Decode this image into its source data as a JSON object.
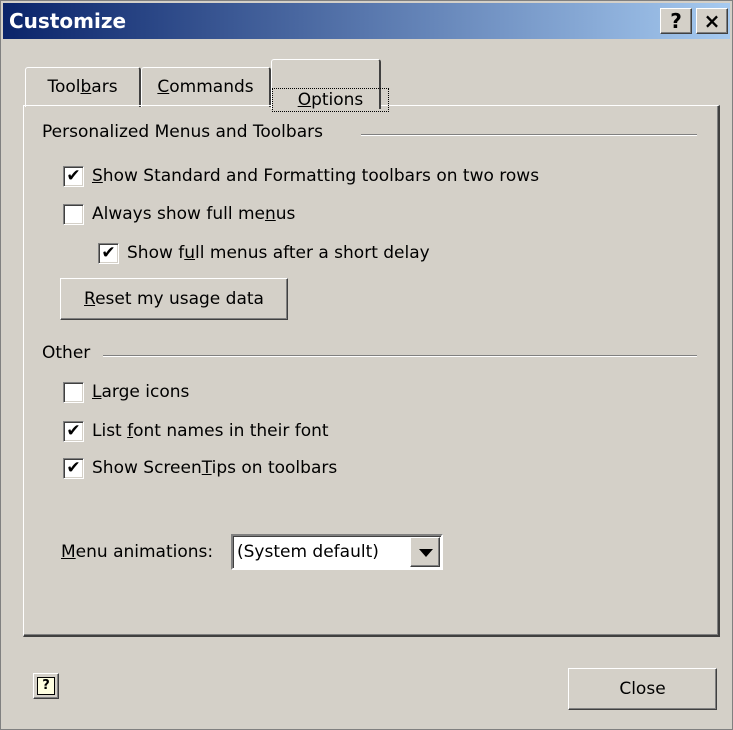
{
  "window": {
    "title": "Customize",
    "help_glyph": "?",
    "close_glyph": "×"
  },
  "tabs": [
    {
      "label": "Toolbars",
      "accel": "b",
      "selected": false
    },
    {
      "label": "Commands",
      "accel": "C",
      "selected": false
    },
    {
      "label": "Options",
      "accel": "O",
      "selected": true
    }
  ],
  "personalized": {
    "title": "Personalized Menus and Toolbars",
    "two_rows": {
      "label": "Show Standard and Formatting toolbars on two rows",
      "checked": true
    },
    "full_menus": {
      "label": "Always show full menus",
      "checked": false
    },
    "delay": {
      "label": "Show full menus after a short delay",
      "checked": true
    },
    "reset_label": "Reset my usage data"
  },
  "other": {
    "title": "Other",
    "large_icons": {
      "label": "Large icons",
      "checked": false
    },
    "font_names": {
      "label": "List font names in their font",
      "checked": true
    },
    "screentips": {
      "label": "Show ScreenTips on toolbars",
      "checked": true
    },
    "menu_animations_label": "Menu animations:",
    "menu_animations_value": "(System default)"
  },
  "footer": {
    "close_label": "Close",
    "help_glyph": "?"
  },
  "colors": {
    "title_start": "#0a246a",
    "title_end": "#a6caf0",
    "face": "#d4d0c8"
  }
}
